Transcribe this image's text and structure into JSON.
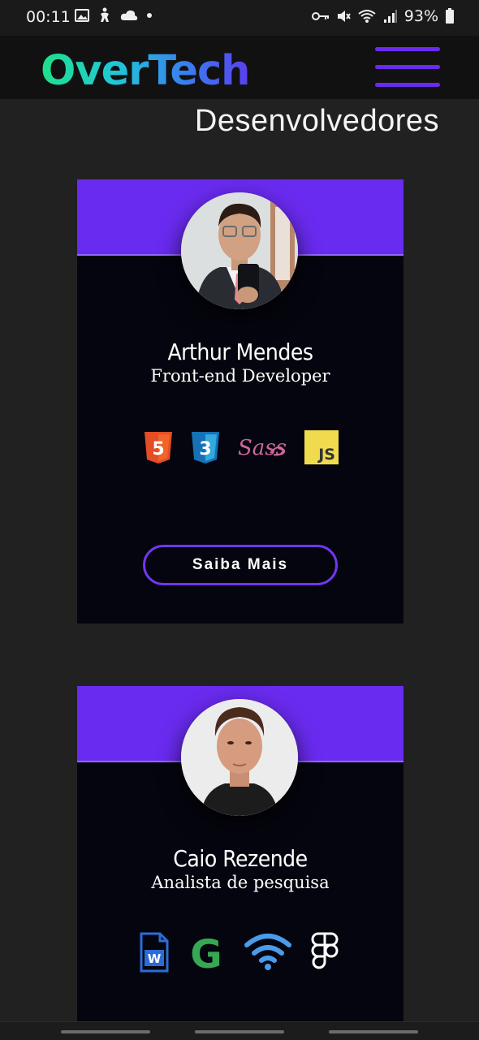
{
  "status_bar": {
    "time": "00:11",
    "battery": "93%",
    "left_icons": [
      "gallery-icon",
      "accessibility-icon",
      "cloud-icon",
      "dot-icon"
    ],
    "right_icons": [
      "vpn-key-icon",
      "mute-icon",
      "wifi-icon",
      "signal-icon",
      "battery-icon"
    ]
  },
  "header": {
    "logo": "OverTech",
    "menu_icon": "hamburger-menu-icon",
    "accent_color": "#6a2bf0"
  },
  "page": {
    "title": "Desenvolvedores"
  },
  "developers": [
    {
      "name": "Arthur Mendes",
      "role": "Front-end Developer",
      "tech": [
        {
          "label": "5",
          "icon": "html5-icon",
          "color": "#e44d26"
        },
        {
          "label": "3",
          "icon": "css3-icon",
          "color": "#1572b6"
        },
        {
          "label": "Sass",
          "icon": "sass-icon",
          "color": "#cd6799"
        },
        {
          "label": "JS",
          "icon": "javascript-icon",
          "color": "#f0db4f"
        }
      ],
      "button": "Saiba Mais"
    },
    {
      "name": "Caio Rezende",
      "role": "Analista de pesquisa",
      "tech": [
        {
          "label": "W",
          "icon": "word-document-icon",
          "color": "#2b6cd4"
        },
        {
          "label": "G",
          "icon": "google-icon",
          "color": "#34a853"
        },
        {
          "label": "",
          "icon": "wifi-icon",
          "color": "#4a9bea"
        },
        {
          "label": "",
          "icon": "figma-icon",
          "color": "#ffffff"
        }
      ]
    }
  ]
}
